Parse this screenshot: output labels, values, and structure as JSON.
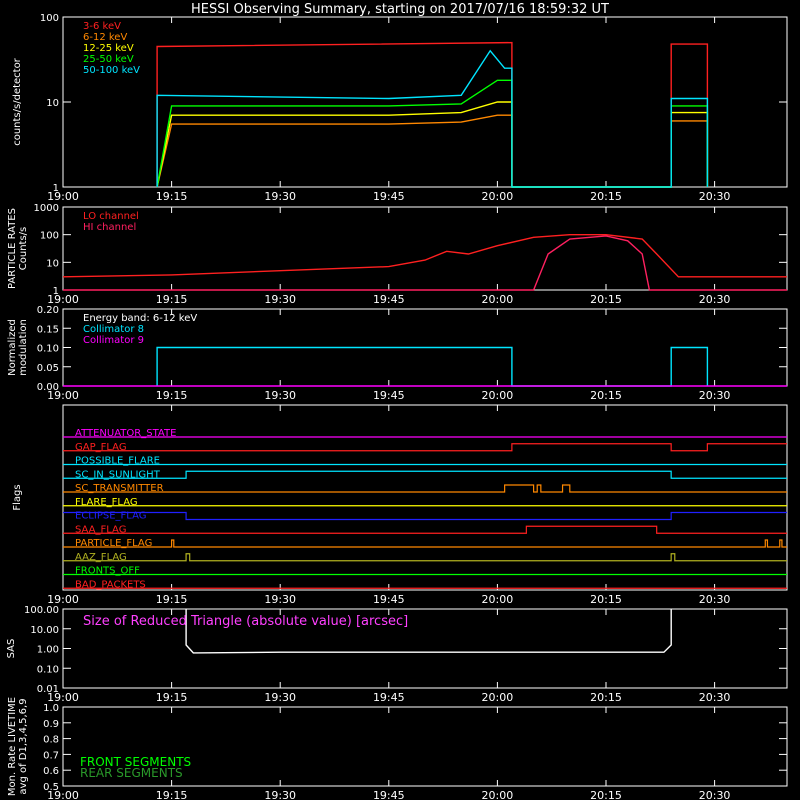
{
  "title": "HESSI Observing Summary, starting on 2017/07/16 18:59:32 UT",
  "time_ticks": [
    "19:00",
    "19:15",
    "19:30",
    "19:45",
    "20:00",
    "20:15",
    "20:30"
  ],
  "chart_data": [
    {
      "type": "line",
      "panel": "count-rates",
      "ylabel": "counts/s/detector",
      "y_scale": "log",
      "ylim": [
        1,
        100
      ],
      "y_ticks": [
        "1",
        "10",
        "100"
      ],
      "xlim": [
        "19:00",
        "20:40"
      ],
      "legend_position": "top-left",
      "series": [
        {
          "name": "3-6 keV",
          "color": "#ff2020",
          "x": [
            "19:13",
            "19:13",
            "20:02",
            "20:02",
            "20:24",
            "20:24",
            "20:29",
            "20:29"
          ],
          "values": [
            1,
            45,
            50,
            1,
            1,
            48,
            48,
            1
          ]
        },
        {
          "name": "6-12 keV",
          "color": "#ff8800",
          "x": [
            "19:13",
            "19:15",
            "19:45",
            "19:55",
            "20:00",
            "20:02",
            "20:02",
            "20:24",
            "20:24",
            "20:29",
            "20:29"
          ],
          "values": [
            1,
            5.5,
            5.5,
            5.8,
            7,
            7,
            1,
            1,
            6,
            6,
            1
          ]
        },
        {
          "name": "12-25 keV",
          "color": "#ffff00",
          "x": [
            "19:13",
            "19:15",
            "19:45",
            "19:55",
            "20:00",
            "20:02",
            "20:02",
            "20:24",
            "20:24",
            "20:29",
            "20:29"
          ],
          "values": [
            1,
            7,
            7,
            7.5,
            10,
            10,
            1,
            1,
            7.5,
            7.5,
            1
          ]
        },
        {
          "name": "25-50 keV",
          "color": "#00ff00",
          "x": [
            "19:13",
            "19:15",
            "19:45",
            "19:55",
            "20:00",
            "20:02",
            "20:02",
            "20:24",
            "20:24",
            "20:29",
            "20:29"
          ],
          "values": [
            1,
            9,
            9,
            9.5,
            18,
            18,
            1,
            1,
            9,
            9,
            1
          ]
        },
        {
          "name": "50-100 keV",
          "color": "#00e5ff",
          "x": [
            "19:13",
            "19:13",
            "19:45",
            "19:55",
            "19:59",
            "20:01",
            "20:02",
            "20:02",
            "20:24",
            "20:24",
            "20:29",
            "20:29"
          ],
          "values": [
            1,
            12,
            11,
            12,
            40,
            25,
            25,
            1,
            1,
            11,
            11,
            1
          ]
        }
      ]
    },
    {
      "type": "line",
      "panel": "particle-rates",
      "ylabel": "PARTICLE RATES\nCounts/s",
      "y_scale": "log",
      "ylim": [
        1,
        1000
      ],
      "y_ticks": [
        "1",
        "10",
        "100",
        "1000"
      ],
      "xlim": [
        "19:00",
        "20:40"
      ],
      "legend_position": "top-left",
      "series": [
        {
          "name": "LO channel",
          "color": "#ff2020",
          "x": [
            "19:00",
            "19:15",
            "19:30",
            "19:45",
            "19:50",
            "19:53",
            "19:56",
            "20:00",
            "20:05",
            "20:10",
            "20:15",
            "20:20",
            "20:22",
            "20:25",
            "20:40"
          ],
          "values": [
            3,
            3.5,
            5,
            7,
            12,
            25,
            20,
            40,
            80,
            100,
            100,
            70,
            20,
            3,
            3
          ]
        },
        {
          "name": "HI channel",
          "color": "#ff2060",
          "x": [
            "19:00",
            "20:05",
            "20:07",
            "20:10",
            "20:15",
            "20:18",
            "20:20",
            "20:21",
            "20:40"
          ],
          "values": [
            1,
            1,
            20,
            70,
            90,
            60,
            20,
            1,
            1
          ]
        }
      ]
    },
    {
      "type": "line",
      "panel": "modulation",
      "ylabel": "Normalized\nmodulation",
      "ylim": [
        0,
        0.2
      ],
      "y_ticks": [
        "0.00",
        "0.05",
        "0.10",
        "0.15",
        "0.20"
      ],
      "xlim": [
        "19:00",
        "20:40"
      ],
      "annotation": "Energy band: 6-12 keV",
      "legend_position": "top-left",
      "series": [
        {
          "name": "Collimator 8",
          "color": "#00e5ff",
          "x": [
            "19:13",
            "19:13",
            "20:02",
            "20:02",
            "20:24",
            "20:24",
            "20:29",
            "20:29"
          ],
          "values": [
            0,
            0.1,
            0.1,
            0,
            0,
            0.1,
            0.1,
            0
          ]
        },
        {
          "name": "Collimator 9",
          "color": "#ff00ff",
          "x": [
            "19:00",
            "20:40"
          ],
          "values": [
            0,
            0
          ]
        }
      ]
    },
    {
      "type": "line",
      "panel": "flags",
      "ylabel": "Flags",
      "xlim": [
        "19:00",
        "20:40"
      ],
      "series": [
        {
          "name": "ATTENUATOR_STATE",
          "color": "#ff00ff",
          "steps": [
            [
              "19:00",
              0
            ],
            [
              "20:40",
              0
            ]
          ]
        },
        {
          "name": "GAP_FLAG",
          "color": "#ff2020",
          "steps": [
            [
              "19:00",
              0
            ],
            [
              "20:02",
              1
            ],
            [
              "20:24",
              0
            ],
            [
              "20:29",
              1
            ],
            [
              "20:40",
              1
            ]
          ]
        },
        {
          "name": "POSSIBLE_FLARE",
          "color": "#00e5ff",
          "steps": [
            [
              "19:00",
              0
            ],
            [
              "20:40",
              0
            ]
          ]
        },
        {
          "name": "SC_IN_SUNLIGHT",
          "color": "#00e5ff",
          "steps": [
            [
              "19:00",
              0
            ],
            [
              "19:17",
              1
            ],
            [
              "20:24",
              0
            ],
            [
              "20:40",
              0
            ]
          ]
        },
        {
          "name": "SC_TRANSMITTER",
          "color": "#ff8800",
          "steps": [
            [
              "19:00",
              0
            ],
            [
              "20:01",
              1
            ],
            [
              "20:05",
              0
            ],
            [
              "20:05.5",
              1
            ],
            [
              "20:06",
              0
            ],
            [
              "20:09",
              1
            ],
            [
              "20:10",
              0
            ],
            [
              "20:40",
              0
            ]
          ]
        },
        {
          "name": "FLARE_FLAG",
          "color": "#ffff00",
          "steps": [
            [
              "19:00",
              0
            ],
            [
              "20:40",
              0
            ]
          ]
        },
        {
          "name": "ECLIPSE_FLAG",
          "color": "#2020ff",
          "steps": [
            [
              "19:00",
              1
            ],
            [
              "19:17",
              0
            ],
            [
              "20:24",
              1
            ],
            [
              "20:40",
              1
            ]
          ]
        },
        {
          "name": "SAA_FLAG",
          "color": "#ff2020",
          "steps": [
            [
              "19:00",
              0
            ],
            [
              "20:04",
              1
            ],
            [
              "20:22",
              0
            ],
            [
              "20:40",
              0
            ]
          ]
        },
        {
          "name": "PARTICLE_FLAG",
          "color": "#ff8800",
          "steps": [
            [
              "19:00",
              0
            ],
            [
              "19:15",
              1
            ],
            [
              "19:15.3",
              0
            ],
            [
              "20:37",
              1
            ],
            [
              "20:37.3",
              0
            ],
            [
              "20:39",
              1
            ],
            [
              "20:39.3",
              0
            ],
            [
              "20:40",
              0
            ]
          ]
        },
        {
          "name": "AAZ_FLAG",
          "color": "#b0b020",
          "steps": [
            [
              "19:00",
              0
            ],
            [
              "19:17",
              1
            ],
            [
              "19:17.5",
              0
            ],
            [
              "20:24",
              1
            ],
            [
              "20:24.5",
              0
            ],
            [
              "20:40",
              0
            ]
          ]
        },
        {
          "name": "FRONTS_OFF",
          "color": "#00ff00",
          "steps": [
            [
              "19:00",
              0
            ],
            [
              "20:40",
              0
            ]
          ]
        },
        {
          "name": "BAD_PACKETS",
          "color": "#ff2020",
          "steps": [
            [
              "19:00",
              0
            ],
            [
              "20:40",
              0
            ]
          ]
        }
      ]
    },
    {
      "type": "line",
      "panel": "sas",
      "ylabel": "SAS",
      "y_scale": "log",
      "ylim": [
        0.01,
        100
      ],
      "y_ticks": [
        "0.01",
        "0.10",
        "1.00",
        "10.00",
        "100.00"
      ],
      "xlim": [
        "19:00",
        "20:40"
      ],
      "annotation": "Size of Reduced Triangle (absolute value) [arcsec]",
      "series": [
        {
          "name": "",
          "color": "#ffffff",
          "x": [
            "19:17",
            "19:17",
            "19:18",
            "19:30",
            "19:45",
            "20:00",
            "20:15",
            "20:23",
            "20:24",
            "20:24"
          ],
          "values": [
            100,
            1.5,
            0.6,
            0.65,
            0.65,
            0.65,
            0.65,
            0.65,
            1.5,
            100
          ]
        }
      ]
    },
    {
      "type": "line",
      "panel": "livetime",
      "ylabel": "Mon. Rate LIVETIME\navg of D1,3,4,5,6,9",
      "ylim": [
        0.5,
        1.0
      ],
      "y_ticks": [
        "0.5",
        "0.6",
        "0.7",
        "0.8",
        "0.9",
        "1.0"
      ],
      "xlim": [
        "19:00",
        "20:40"
      ],
      "legend_position": "bottom-left",
      "series": [
        {
          "name": "FRONT SEGMENTS",
          "color": "#00ff00",
          "values": []
        },
        {
          "name": "REAR SEGMENTS",
          "color": "#2a9a2a",
          "values": []
        }
      ]
    }
  ]
}
